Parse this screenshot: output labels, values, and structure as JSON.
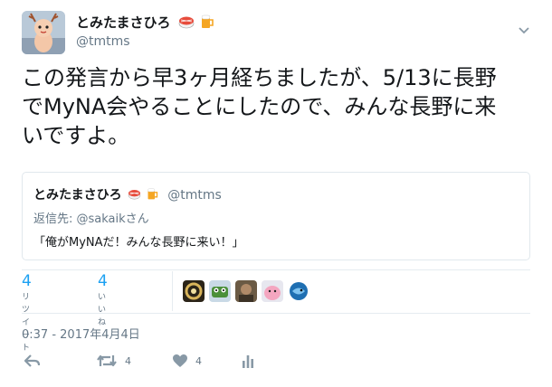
{
  "author": {
    "name": "とみたまさひろ",
    "name_emojis": [
      "sushi-emoji",
      "beer-emoji"
    ],
    "handle": "@tmtms",
    "avatar": "kewpie-doll-avatar"
  },
  "tweet": {
    "lines": [
      "この発言から早3ヶ月経ちましたが、5/13に長野",
      "でMyNA会やることにしたので、みんな長野に来",
      "いですよ。"
    ]
  },
  "quoted_tweet": {
    "name": "とみたまさひろ",
    "handle": "@tmtms",
    "reply_to": "返信先: @sakaikさん",
    "text": "「俺がMyNAだ！みんな長野に来い！」"
  },
  "stats": {
    "retweets": {
      "count": "4",
      "label": "リツイート"
    },
    "likes": {
      "count": "4",
      "label": "いいね"
    }
  },
  "liker_avatars": [
    "ring-avatar",
    "frog-avatar",
    "photo-avatar",
    "pink-character-avatar",
    "fish-avatar"
  ],
  "timestamp": "0:37 - 2017年4月4日",
  "actions": {
    "reply": {
      "icon": "reply-icon"
    },
    "retweet": {
      "icon": "retweet-icon",
      "count": "4"
    },
    "like": {
      "icon": "heart-icon",
      "count": "4"
    },
    "analytics": {
      "icon": "analytics-icon"
    }
  },
  "colors": {
    "link_blue": "#1da1f2",
    "secondary_text": "#657786",
    "primary_text": "#14171a",
    "border": "#e1e8ed"
  }
}
